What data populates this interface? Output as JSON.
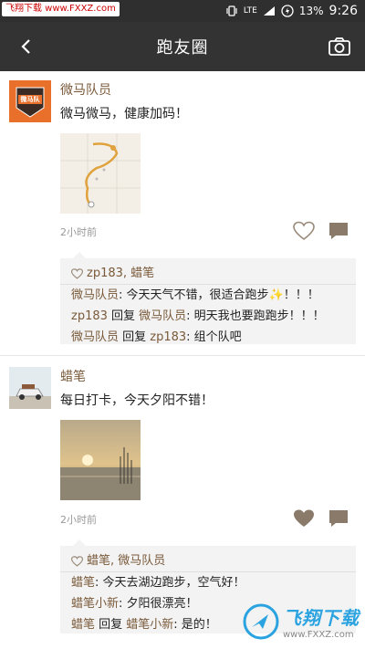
{
  "statusbar": {
    "watermark": "飞翔下载 www.FXXZ.com",
    "network": "LTE",
    "battery": "13%",
    "time": "9:26"
  },
  "appbar": {
    "title": "跑友圈",
    "back_icon": "back-arrow-icon",
    "camera_icon": "camera-icon"
  },
  "posts": [
    {
      "author": "微马队员",
      "avatar_text": "微马队",
      "text": "微马微马，健康加码！",
      "time": "2小时前",
      "liked": false,
      "likes": "zp183, 蜡笔",
      "comments": [
        {
          "name": "微马队员",
          "text": ": 今天天气不错，很适合跑步✨！！！"
        },
        {
          "name": "zp183",
          "reply_word": " 回复 ",
          "to": "微马队员",
          "text": ": 明天我也要跑跑步！！！"
        },
        {
          "name": "微马队员",
          "reply_word": " 回复 ",
          "to": "zp183",
          "text": ": 组个队吧"
        }
      ]
    },
    {
      "author": "蜡笔",
      "text": "每日打卡，今天夕阳不错！",
      "time": "2小时前",
      "liked": true,
      "likes": "蜡笔, 微马队员",
      "comments": [
        {
          "name": "蜡笔",
          "text": ": 今天去湖边跑步，空气好！"
        },
        {
          "name": "蜡笔小新",
          "text": ": 夕阳很漂亮！"
        },
        {
          "name": "蜡笔",
          "reply_word": " 回复 ",
          "to": "蜡笔小新",
          "text": ": 是的！"
        }
      ]
    }
  ],
  "bottom_watermark": {
    "big": "飞翔下载",
    "small": "www.FXXZ.com"
  },
  "colors": {
    "appbar": "#333333",
    "name": "#7a5a3a",
    "comment_bg": "#f3f3f3"
  }
}
